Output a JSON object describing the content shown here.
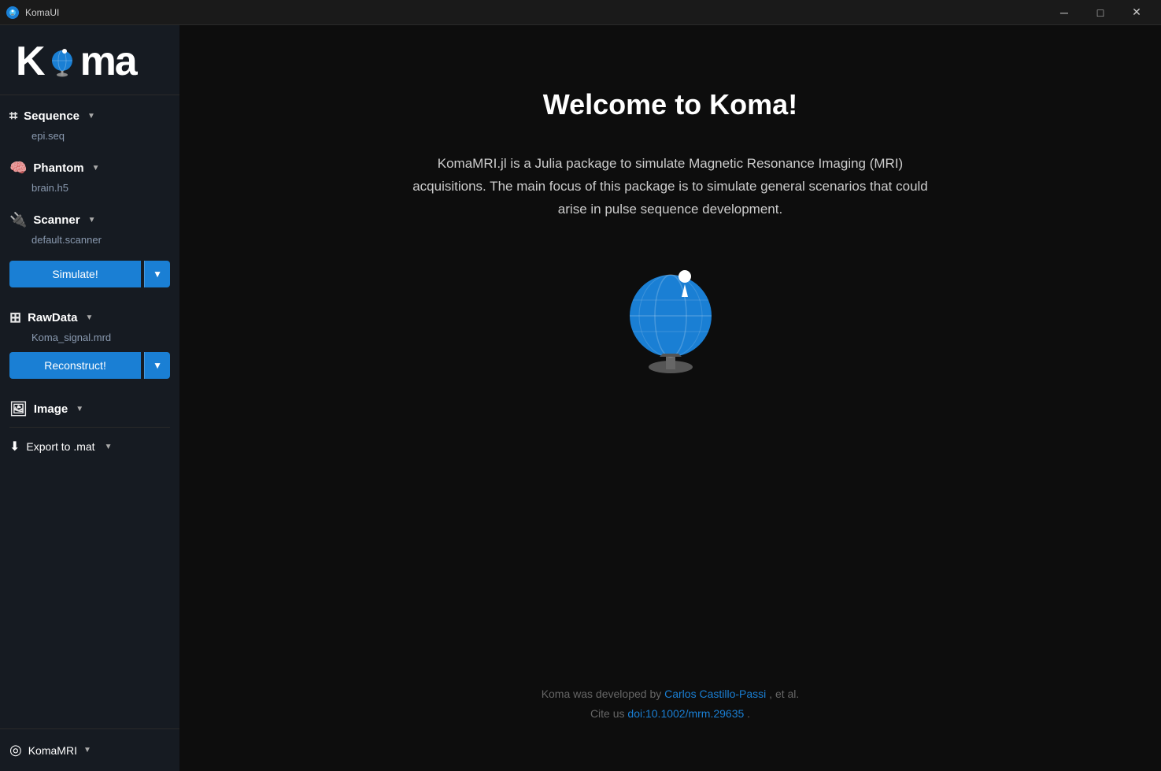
{
  "titlebar": {
    "title": "KomaUI",
    "minimize_label": "─",
    "maximize_label": "□",
    "close_label": "✕"
  },
  "sidebar": {
    "logo": "Koma",
    "sequence": {
      "label": "Sequence",
      "file": "epi.seq"
    },
    "phantom": {
      "label": "Phantom",
      "file": "brain.h5"
    },
    "scanner": {
      "label": "Scanner",
      "file": "default.scanner"
    },
    "simulate_btn": "Simulate!",
    "rawdata": {
      "label": "RawData",
      "file": "Koma_signal.mrd"
    },
    "reconstruct_btn": "Reconstruct!",
    "image": {
      "label": "Image"
    },
    "export": {
      "label": "Export to .mat"
    },
    "bottom": {
      "label": "KomaMRI"
    }
  },
  "main": {
    "welcome_title": "Welcome to Koma!",
    "welcome_desc": "KomaMRI.jl is a Julia package to simulate Magnetic Resonance Imaging (MRI) acquisitions. The main focus of this package is to simulate general scenarios that could arise in pulse sequence development.",
    "footer_text_1": "Koma was developed by ",
    "footer_author": "Carlos Castillo-Passi",
    "footer_text_2": ", et al.",
    "footer_cite": "Cite us ",
    "footer_doi": "doi:10.1002/mrm.29635",
    "footer_text_3": "."
  }
}
